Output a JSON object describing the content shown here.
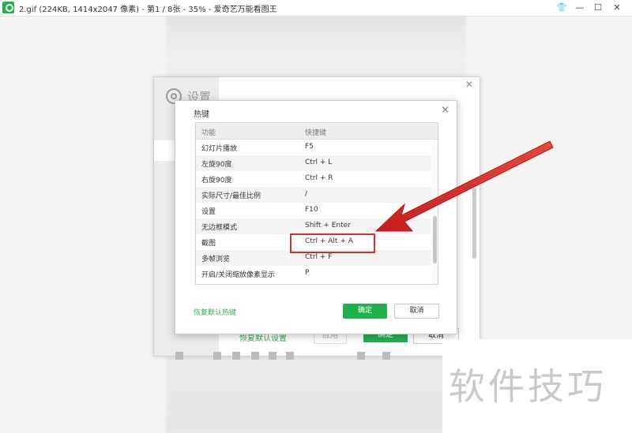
{
  "window": {
    "title": "2.gif (224KB, 1414x2047 像素) - 第1 / 8张 - 35% - 爱奇艺万能看图王",
    "buttons": {
      "skin": "👕",
      "minimize": "—",
      "maximize": "☐",
      "close": "✕"
    }
  },
  "settings_dialog": {
    "title": "设置",
    "restore_label": "恢复默认设置",
    "apply_label": "应用",
    "ok_label": "确定",
    "cancel_label": "取消"
  },
  "hotkey_dialog": {
    "title": "热键",
    "close": "×",
    "columns": [
      "功能",
      "快捷键"
    ],
    "rows": [
      {
        "function": "幻灯片播放",
        "key": "F5"
      },
      {
        "function": "左旋90度",
        "key": "Ctrl + L"
      },
      {
        "function": "右旋90度",
        "key": "Ctrl + R"
      },
      {
        "function": "实际尺寸/最佳比例",
        "key": "/"
      },
      {
        "function": "设置",
        "key": "F10"
      },
      {
        "function": "无边框模式",
        "key": "Shift + Enter"
      },
      {
        "function": "截图",
        "key": "Ctrl + Alt + A"
      },
      {
        "function": "多帧浏览",
        "key": "Ctrl + F"
      },
      {
        "function": "开启/关闭缩放像素显示",
        "key": "P"
      }
    ],
    "restore_label": "恢复默认热键",
    "ok_label": "确定",
    "cancel_label": "取消"
  },
  "annotation": {
    "highlight_color": "#d92c2c"
  },
  "watermark": {
    "text": "软件技巧"
  },
  "colors": {
    "accent_green": "#1fb24b"
  }
}
